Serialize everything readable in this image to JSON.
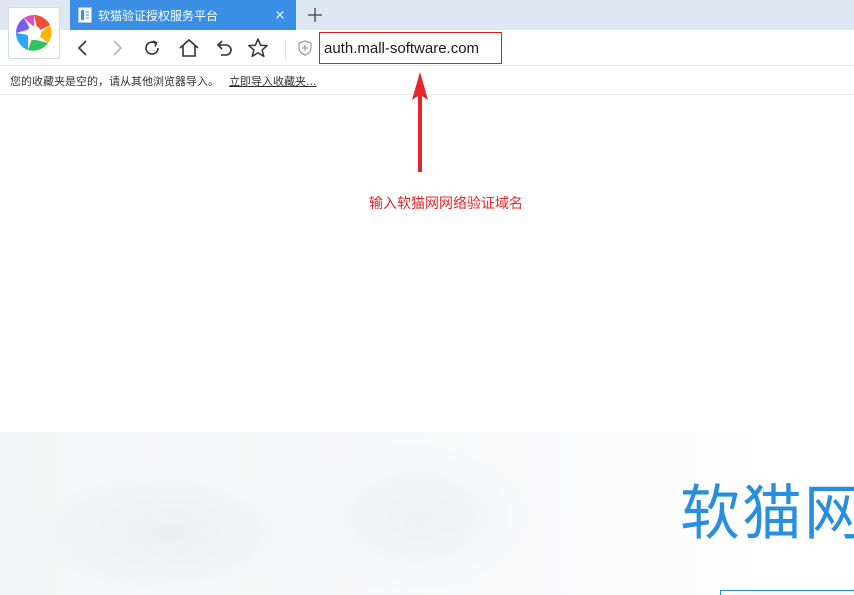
{
  "browser": {
    "tab": {
      "title": "软猫验证授权服务平台",
      "close_symbol": "×"
    },
    "new_tab_symbol": "+",
    "address_bar": {
      "url": "auth.mall-software.com"
    },
    "nav_icons": [
      "back-icon",
      "forward-icon",
      "reload-icon",
      "home-icon",
      "undo-icon",
      "favorite-star-icon",
      "security-shield-icon"
    ],
    "bookmarks_bar": {
      "empty_message": "您的收藏夹是空的，请从其他浏览器导入。",
      "import_link": "立即导入收藏夹..."
    }
  },
  "annotation": {
    "text": "输入软猫网网络验证域名",
    "color": "#e0282c"
  },
  "website": {
    "heading": "软猫网",
    "accent_color": "#2a8ee0"
  },
  "colors": {
    "tab_active": "#3a8ee6",
    "tabstrip_bg": "#dfe8f2",
    "highlight_red": "#e02020"
  }
}
